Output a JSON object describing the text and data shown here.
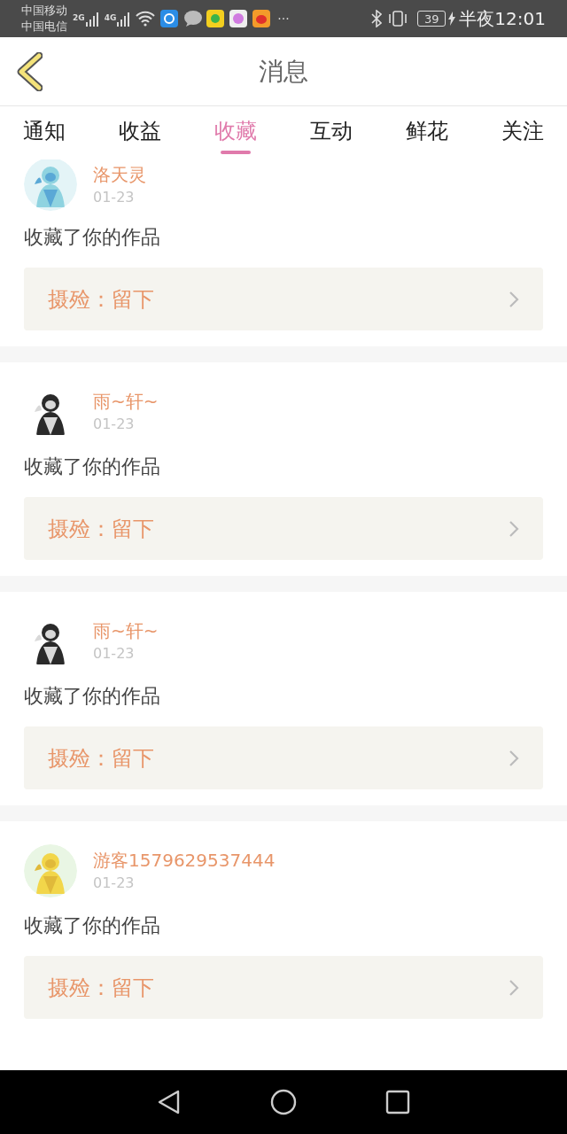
{
  "status_bar": {
    "carriers": [
      "中国移动",
      "中国电信"
    ],
    "networks": [
      "2G",
      "4G"
    ],
    "more": "···",
    "battery": "39",
    "time": "半夜12:01"
  },
  "header": {
    "title": "消息"
  },
  "tabs": [
    {
      "label": "通知",
      "selected": false
    },
    {
      "label": "收益",
      "selected": false
    },
    {
      "label": "收藏",
      "selected": true
    },
    {
      "label": "互动",
      "selected": false
    },
    {
      "label": "鲜花",
      "selected": false
    },
    {
      "label": "关注",
      "selected": false
    }
  ],
  "messages": [
    {
      "user": "洛天灵",
      "date": "01-23",
      "text": "收藏了你的作品",
      "work": "摄殓：留下"
    },
    {
      "user": "雨~轩~",
      "date": "01-23",
      "text": "收藏了你的作品",
      "work": "摄殓：留下"
    },
    {
      "user": "雨~轩~",
      "date": "01-23",
      "text": "收藏了你的作品",
      "work": "摄殓：留下"
    },
    {
      "user": "游客1579629537444",
      "date": "01-23",
      "text": "收藏了你的作品",
      "work": "摄殓：留下"
    }
  ]
}
